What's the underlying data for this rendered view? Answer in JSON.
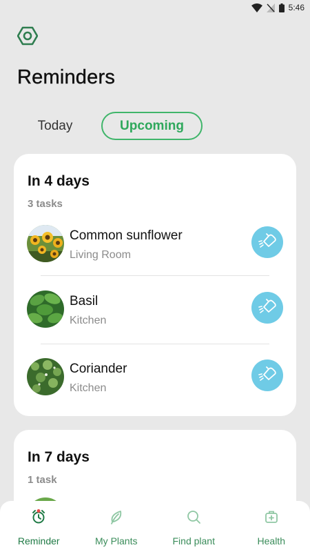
{
  "status_bar": {
    "time": "5:46"
  },
  "header": {
    "title": "Reminders"
  },
  "tabs": [
    {
      "label": "Today",
      "active": false
    },
    {
      "label": "Upcoming",
      "active": true
    }
  ],
  "groups": [
    {
      "title": "In 4 days",
      "subtitle": "3 tasks",
      "plants": [
        {
          "name": "Common sunflower",
          "location": "Living Room",
          "action_icon": "watering-icon"
        },
        {
          "name": "Basil",
          "location": "Kitchen",
          "action_icon": "watering-icon"
        },
        {
          "name": "Coriander",
          "location": "Kitchen",
          "action_icon": "watering-icon"
        }
      ]
    },
    {
      "title": "In 7 days",
      "subtitle": "1 task",
      "plants": []
    }
  ],
  "nav": [
    {
      "label": "Reminder",
      "icon": "alarm-clock-icon",
      "active": true
    },
    {
      "label": "My Plants",
      "icon": "leaf-icon",
      "active": false
    },
    {
      "label": "Find plant",
      "icon": "search-icon",
      "active": false
    },
    {
      "label": "Health",
      "icon": "medkit-icon",
      "active": false
    }
  ],
  "colors": {
    "accent": "#3fb56a",
    "water": "#6fcbe6",
    "background": "#e8e8e8"
  }
}
